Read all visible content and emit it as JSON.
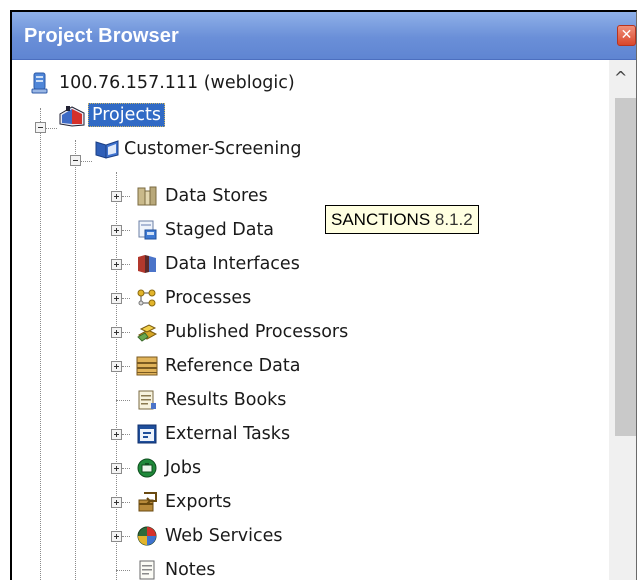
{
  "panel": {
    "title": "Project Browser",
    "close_glyph": "✕"
  },
  "tree": {
    "server": {
      "label": "100.76.157.111 (weblogic)",
      "icon": "server-icon"
    },
    "projects": {
      "label": "Projects",
      "icon": "projects-icon"
    },
    "project": {
      "label": "Customer-Screening",
      "icon": "book-icon"
    },
    "items": [
      {
        "label": "Data Stores",
        "icon": "data-stores-icon",
        "expandable": true
      },
      {
        "label": "Staged Data",
        "icon": "staged-data-icon",
        "expandable": true
      },
      {
        "label": "Data Interfaces",
        "icon": "data-interfaces-icon",
        "expandable": true
      },
      {
        "label": "Processes",
        "icon": "processes-icon",
        "expandable": true
      },
      {
        "label": "Published Processors",
        "icon": "published-processors-icon",
        "expandable": true
      },
      {
        "label": "Reference Data",
        "icon": "reference-data-icon",
        "expandable": true
      },
      {
        "label": "Results Books",
        "icon": "results-books-icon",
        "expandable": false
      },
      {
        "label": "External Tasks",
        "icon": "external-tasks-icon",
        "expandable": true
      },
      {
        "label": "Jobs",
        "icon": "jobs-icon",
        "expandable": true
      },
      {
        "label": "Exports",
        "icon": "exports-icon",
        "expandable": true
      },
      {
        "label": "Web Services",
        "icon": "web-services-icon",
        "expandable": true
      },
      {
        "label": "Notes",
        "icon": "notes-icon",
        "expandable": false
      }
    ]
  },
  "tooltip": {
    "name": "SANCTIONS",
    "version": "8.1.2"
  },
  "scrollbar": {
    "up_glyph": "^"
  }
}
